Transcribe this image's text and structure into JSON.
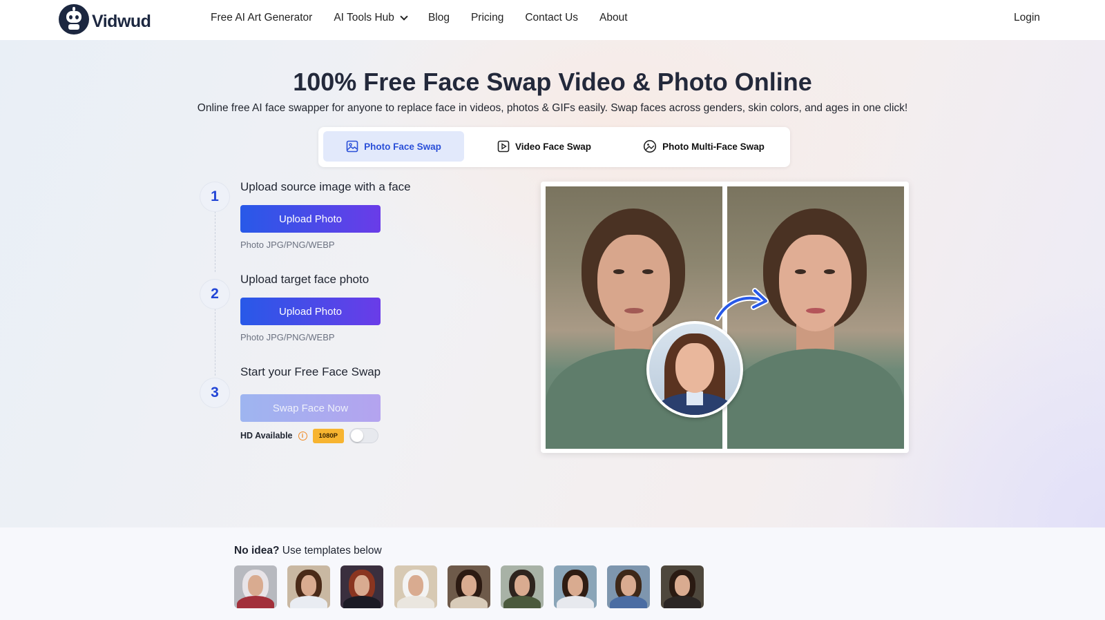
{
  "brand": {
    "name": "Vidwud"
  },
  "nav": {
    "links": [
      "Free AI Art Generator",
      "AI Tools Hub",
      "Blog",
      "Pricing",
      "Contact Us",
      "About"
    ],
    "login": "Login"
  },
  "hero": {
    "title": "100% Free Face Swap Video & Photo Online",
    "subtitle": "Online free AI face swapper for anyone to replace face in videos, photos & GIFs easily. Swap faces across genders, skin colors, and ages in one click!"
  },
  "tabs": [
    {
      "label": "Photo Face Swap",
      "icon": "image-icon",
      "active": true
    },
    {
      "label": "Video Face Swap",
      "icon": "video-play-icon",
      "active": false
    },
    {
      "label": "Photo Multi-Face Swap",
      "icon": "multi-face-icon",
      "active": false
    }
  ],
  "steps": [
    {
      "num": "1",
      "title": "Upload source image with a face",
      "button": "Upload Photo",
      "hint": "Photo JPG/PNG/WEBP"
    },
    {
      "num": "2",
      "title": "Upload target face photo",
      "button": "Upload Photo",
      "hint": "Photo JPG/PNG/WEBP"
    },
    {
      "num": "3",
      "title": "Start your Free Face Swap",
      "button": "Swap Face Now"
    }
  ],
  "hd": {
    "label": "HD Available",
    "badge": "1080P",
    "enabled": false
  },
  "templates": {
    "title_bold": "No idea?",
    "title_rest": " Use templates below",
    "count": 9
  },
  "colors": {
    "accent": "#2859e8",
    "accent2": "#6a3ce8",
    "badge": "#f7b430",
    "step_num": "#2245d6"
  }
}
